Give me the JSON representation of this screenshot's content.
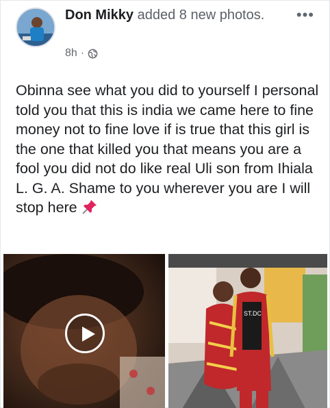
{
  "post": {
    "author": "Don Mikky",
    "action": "added 8 new photos.",
    "timestamp": "8h",
    "separator": "·",
    "privacy_icon": "globe-icon",
    "more_label": "•••",
    "text": "Obinna see what you did to yourself I personal told you that this is india we came here to fine money not to fine love if is true that this girl is the one that killed you that means you are a fool you did not do like real Uli son from Ihiala L. G. A. Shame to you wherever you are I will stop here",
    "trailing_emoji": "pushpin-icon",
    "shirt_text": "ST.DC"
  },
  "media": {
    "left_icon": "play-icon",
    "colors": {
      "left_bg": "#3a2418",
      "right_bg": "#d9cfc4",
      "dress_red": "#c0282b"
    }
  }
}
